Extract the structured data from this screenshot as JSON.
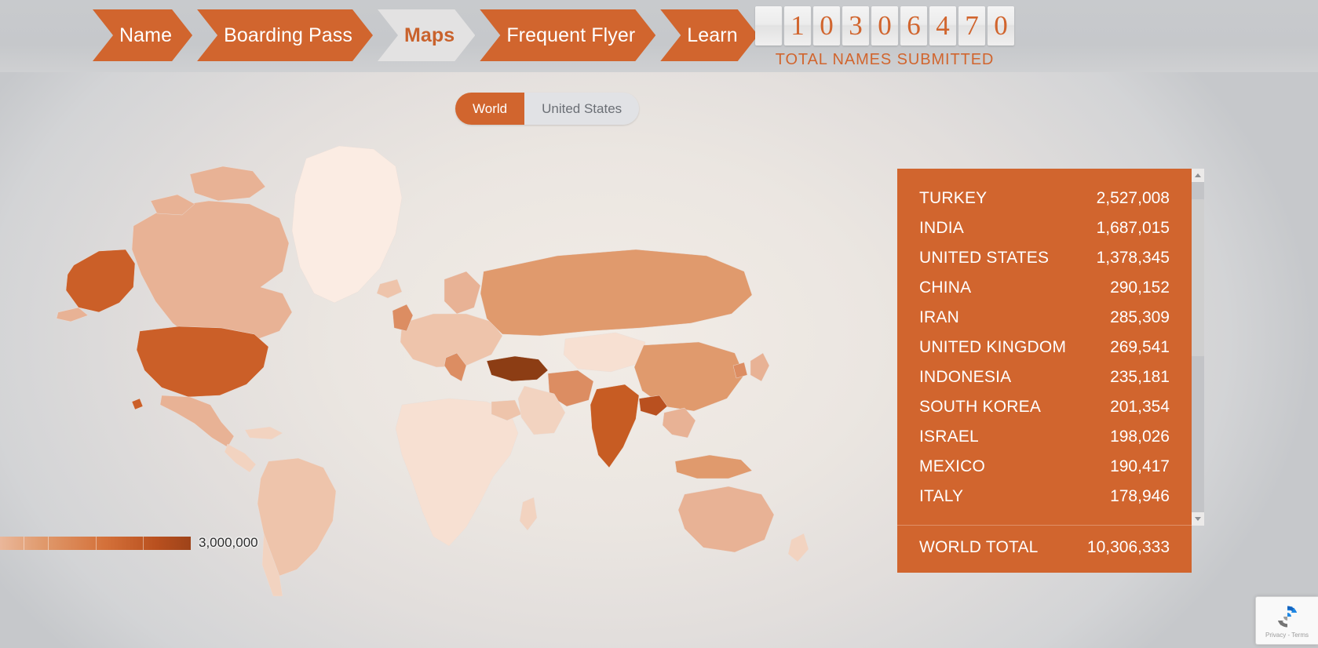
{
  "header": {
    "breadcrumb": [
      {
        "label": "Name",
        "active": false
      },
      {
        "label": "Boarding Pass",
        "active": false
      },
      {
        "label": "Maps",
        "active": true
      },
      {
        "label": "Frequent Flyer",
        "active": false
      },
      {
        "label": "Learn",
        "active": false
      }
    ],
    "counter": {
      "digits": [
        "",
        "1",
        "0",
        "3",
        "0",
        "6",
        "4",
        "7",
        "0"
      ],
      "label": "TOTAL NAMES SUBMITTED",
      "value": "10306470"
    }
  },
  "scope_toggle": {
    "options": [
      {
        "label": "World",
        "active": true
      },
      {
        "label": "United States",
        "active": false
      }
    ]
  },
  "legend": {
    "max_label": "3,000,000",
    "gradient_stops": [
      "#eab79a",
      "#e09a6d",
      "#d4713a",
      "#b9501f",
      "#9e4319"
    ]
  },
  "colors": {
    "accent": "#d1652e",
    "panel_bg": "#d1652e",
    "crumb_active_bg": "#e3e2e2",
    "crumb_active_text": "#c9622c",
    "counter_digit_text": "#d1652e",
    "map_land_min": "#f7e4d8",
    "map_land_max": "#8c3d14"
  },
  "panel": {
    "rows": [
      {
        "name": "TURKEY",
        "value": "2,527,008"
      },
      {
        "name": "INDIA",
        "value": "1,687,015"
      },
      {
        "name": "UNITED STATES",
        "value": "1,378,345"
      },
      {
        "name": "CHINA",
        "value": "290,152"
      },
      {
        "name": "IRAN",
        "value": "285,309"
      },
      {
        "name": "UNITED KINGDOM",
        "value": "269,541"
      },
      {
        "name": "INDONESIA",
        "value": "235,181"
      },
      {
        "name": "SOUTH KOREA",
        "value": "201,354"
      },
      {
        "name": "ISRAEL",
        "value": "198,026"
      },
      {
        "name": "MEXICO",
        "value": "190,417"
      },
      {
        "name": "ITALY",
        "value": "178,946"
      }
    ],
    "total": {
      "name": "WORLD TOTAL",
      "value": "10,306,333"
    }
  },
  "recaptcha": {
    "text": "Privacy - Terms"
  },
  "chart_data": {
    "type": "map",
    "title": "Total names submitted by country",
    "legend_max": 3000000,
    "legend_min": 0,
    "categories": [
      "TURKEY",
      "INDIA",
      "UNITED STATES",
      "CHINA",
      "IRAN",
      "UNITED KINGDOM",
      "INDONESIA",
      "SOUTH KOREA",
      "ISRAEL",
      "MEXICO",
      "ITALY"
    ],
    "values": [
      2527008,
      1687015,
      1378345,
      290152,
      285309,
      269541,
      235181,
      201354,
      198026,
      190417,
      178946
    ],
    "total": 10306333
  }
}
